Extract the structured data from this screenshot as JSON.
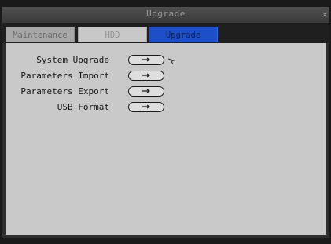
{
  "window": {
    "title": "Upgrade",
    "close_glyph": "×"
  },
  "tabs": [
    {
      "label": "Maintenance",
      "active": false
    },
    {
      "label": "HDD",
      "active": false
    },
    {
      "label": "Upgrade",
      "active": true
    }
  ],
  "upgrade_panel": {
    "rows": [
      {
        "label": "System Upgrade",
        "button_icon": "enter-icon"
      },
      {
        "label": "Parameters Import",
        "button_icon": "enter-icon"
      },
      {
        "label": "Parameters Export",
        "button_icon": "enter-icon"
      },
      {
        "label": "USB Format",
        "button_icon": "enter-icon"
      }
    ]
  },
  "colors": {
    "active_tab": "#1c4fc8",
    "panel_background": "#c9c9c9",
    "frame": "#2e2e2e"
  }
}
